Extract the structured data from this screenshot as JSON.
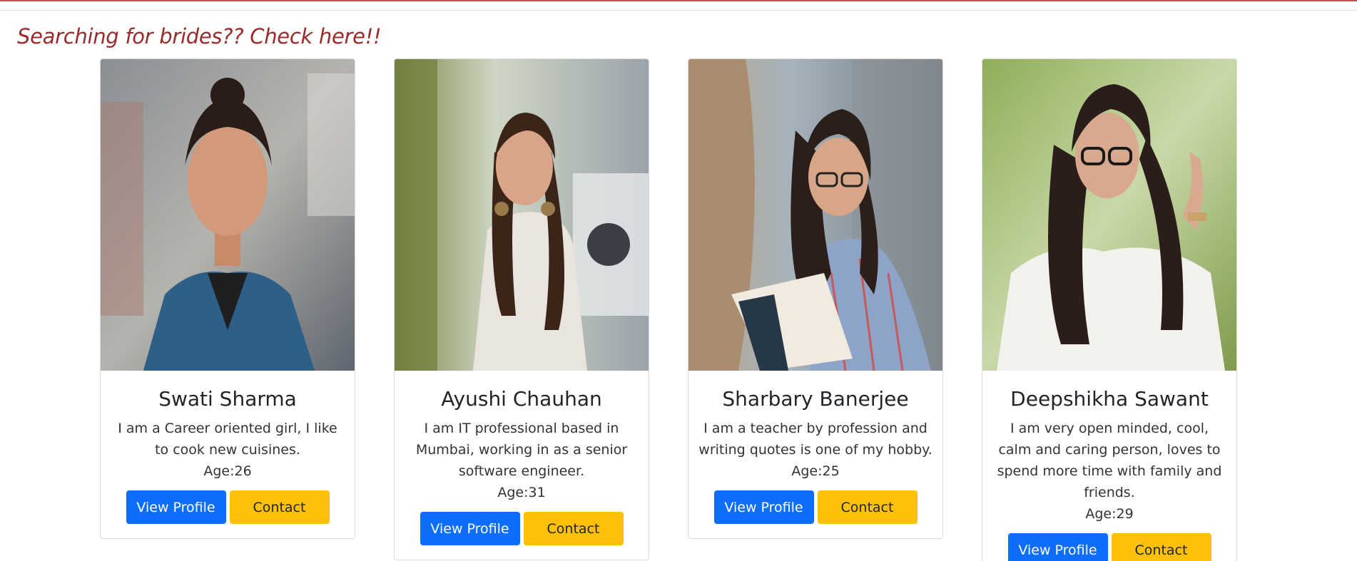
{
  "page": {
    "heading": "Searching for brides?? Check here!!"
  },
  "cards": [
    {
      "name": "Swati Sharma",
      "description": "I am a Career oriented girl, I like to cook new cuisines.",
      "age": "Age:26",
      "view_label": "View Profile",
      "contact_label": "Contact"
    },
    {
      "name": "Ayushi Chauhan",
      "description": "I am IT professional based in Mumbai, working in as a senior software engineer.",
      "age": "Age:31",
      "view_label": "View Profile",
      "contact_label": "Contact"
    },
    {
      "name": "Sharbary Banerjee",
      "description": "I am a teacher by profession and writing quotes is one of my hobby.",
      "age": "Age:25",
      "view_label": "View Profile",
      "contact_label": "Contact"
    },
    {
      "name": "Deepshikha Sawant",
      "description": "I am very open minded, cool, calm and caring person, loves to spend more time with family and friends.",
      "age": "Age:29",
      "view_label": "View Profile",
      "contact_label": "Contact"
    }
  ],
  "colors": {
    "heading": "#9b2b2b",
    "primary_button": "#0d6efd",
    "warning_button": "#ffc107"
  }
}
